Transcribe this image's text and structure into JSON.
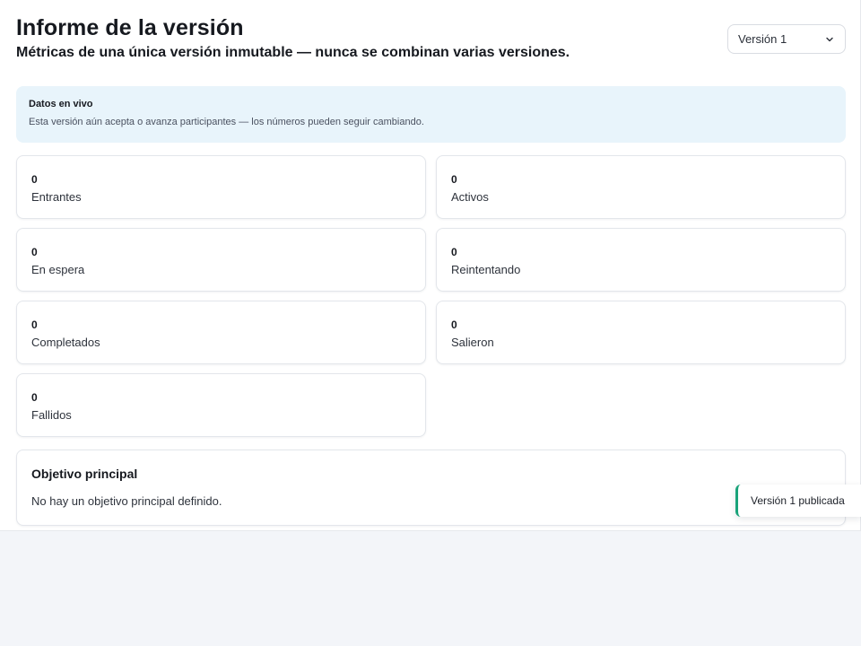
{
  "header": {
    "title": "Informe de la versión",
    "subtitle": "Métricas de una única versión inmutable — nunca se combinan varias versiones."
  },
  "version_select": {
    "selected": "Versión 1",
    "icon": "chevron-down-icon"
  },
  "banner": {
    "title": "Datos en vivo",
    "text": "Esta versión aún acepta o avanza participantes — los números pueden seguir cambiando."
  },
  "metrics": [
    {
      "value": "0",
      "label": "Entrantes"
    },
    {
      "value": "0",
      "label": "Activos"
    },
    {
      "value": "0",
      "label": "En espera"
    },
    {
      "value": "0",
      "label": "Reintentando"
    },
    {
      "value": "0",
      "label": "Completados"
    },
    {
      "value": "0",
      "label": "Salieron"
    },
    {
      "value": "0",
      "label": "Fallidos"
    }
  ],
  "goal": {
    "title": "Objetivo principal",
    "text": "No hay un objetivo principal definido."
  },
  "toast": {
    "text": "Versión 1 publicada",
    "accent": "#1aa37a"
  },
  "colors": {
    "banner_bg": "#e8f4fb",
    "page_bg": "#f3f5f9",
    "accent": "#1aa37a"
  }
}
